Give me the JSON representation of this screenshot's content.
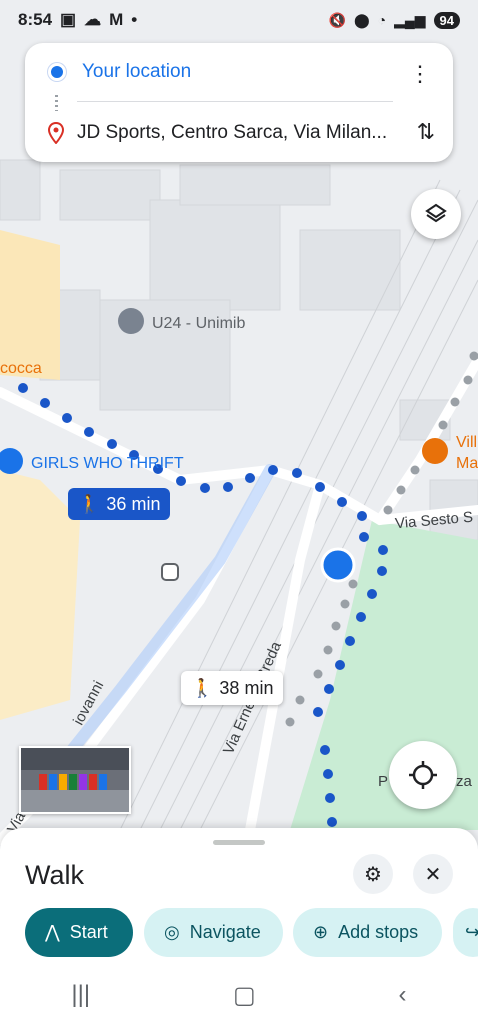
{
  "status_bar": {
    "time": "8:54",
    "battery": "94",
    "icons_left": [
      "screen-record-icon",
      "cloud-icon",
      "gmail-icon",
      "dot-icon"
    ],
    "icons_right": [
      "mute-icon",
      "location-icon",
      "wifi-icon",
      "signal-icon"
    ]
  },
  "route": {
    "origin": "Your location",
    "destination": "JD Sports, Centro Sarca, Via Milan..."
  },
  "map": {
    "labels": {
      "poi_u24": "U24 - Unimib",
      "poi_cocca": "cocca",
      "poi_girls": "GIRLS WHO THRIFT",
      "poi_vill_1": "Vill",
      "poi_vill_2": "Ma",
      "street_sesto": "Via Sesto S",
      "street_breda": "Via Ernesto Breda",
      "street_giovanni": "iovanni",
      "street_via": "Via",
      "park_p": "P",
      "park_za": "za"
    },
    "route_chips": {
      "primary": "36 min",
      "alternate": "38 min"
    }
  },
  "sheet": {
    "mode": "Walk",
    "buttons": {
      "start": "Start",
      "navigate": "Navigate",
      "add_stops": "Add stops"
    }
  },
  "colors": {
    "route_blue": "#1a56c8",
    "accent_teal": "#0b6e7a",
    "chip_teal_bg": "#d6f2f3",
    "park_green": "#c9ecd4"
  }
}
